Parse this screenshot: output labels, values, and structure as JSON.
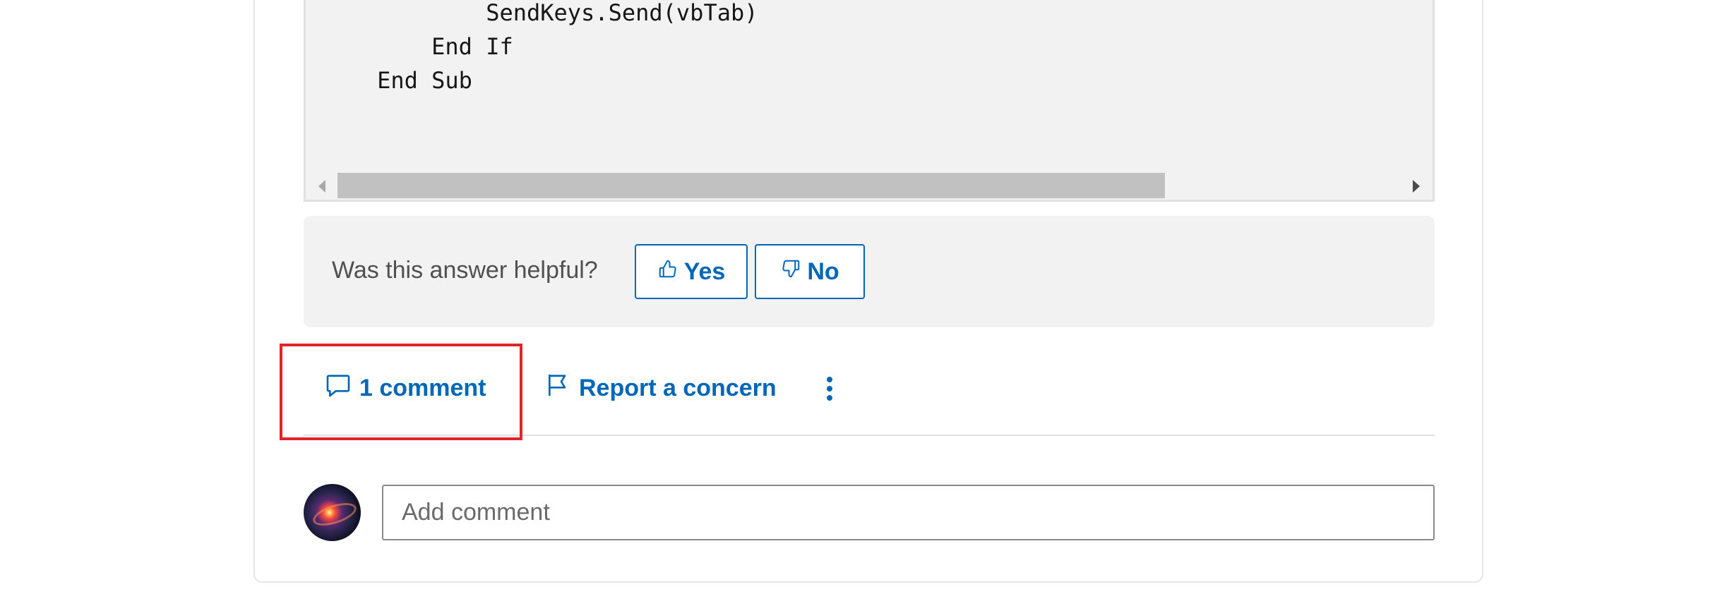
{
  "code": {
    "lines": [
      "            SendKeys.Send(vbTab)",
      "        End If",
      "    End Sub"
    ]
  },
  "feedback": {
    "question": "Was this answer helpful?",
    "yes_label": "Yes",
    "no_label": "No"
  },
  "actions": {
    "comment_count_label": "1 comment",
    "report_label": "Report a concern"
  },
  "comment_box": {
    "placeholder": "Add comment"
  },
  "colors": {
    "accent": "#0067b8",
    "highlight": "#e1242b"
  }
}
